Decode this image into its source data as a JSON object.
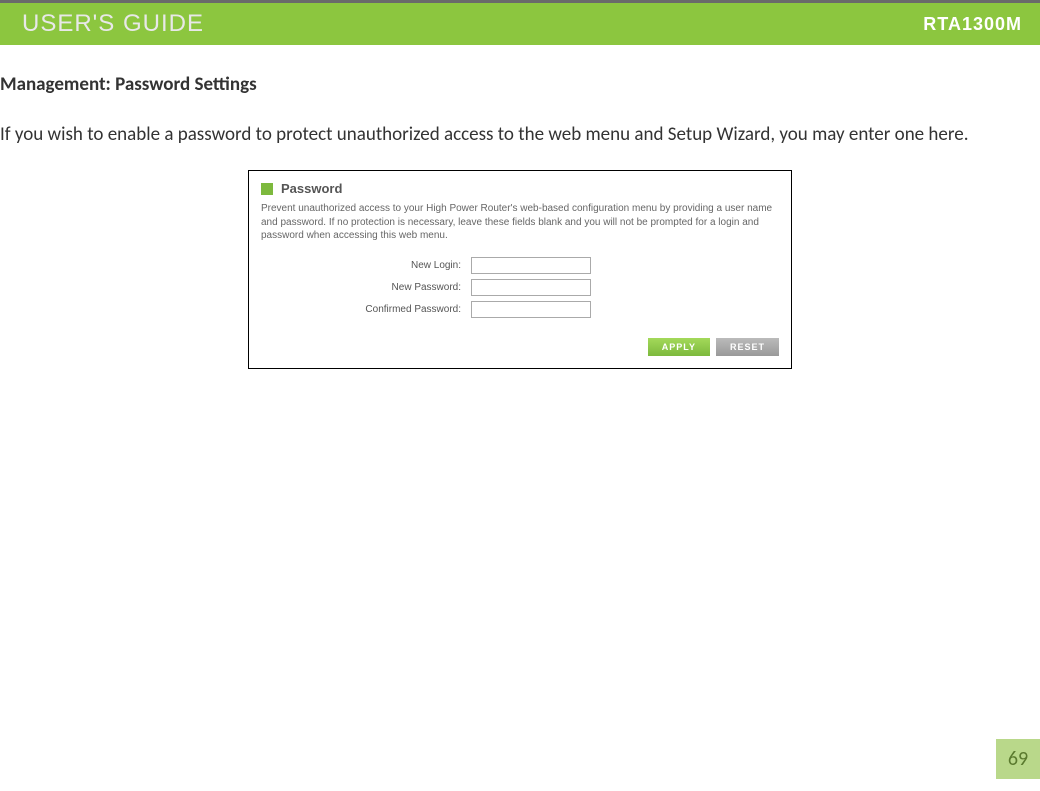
{
  "header": {
    "title": "USER'S GUIDE",
    "model": "RTA1300M"
  },
  "section": {
    "heading": "Management: Password Settings",
    "description": "If you wish to enable a password to protect unauthorized access to the web menu and Setup Wizard, you may enter one here."
  },
  "panel": {
    "title": "Password",
    "description": "Prevent unauthorized access to your High Power Router's web-based configuration menu by providing a user name and password. If no protection is necessary, leave these fields blank and you will not be prompted for a login and password when accessing this web menu.",
    "fields": {
      "newLogin": {
        "label": "New Login:",
        "value": ""
      },
      "newPassword": {
        "label": "New Password:",
        "value": ""
      },
      "confirmedPassword": {
        "label": "Confirmed Password:",
        "value": ""
      }
    },
    "buttons": {
      "apply": "APPLY",
      "reset": "RESET"
    }
  },
  "pageNumber": "69"
}
